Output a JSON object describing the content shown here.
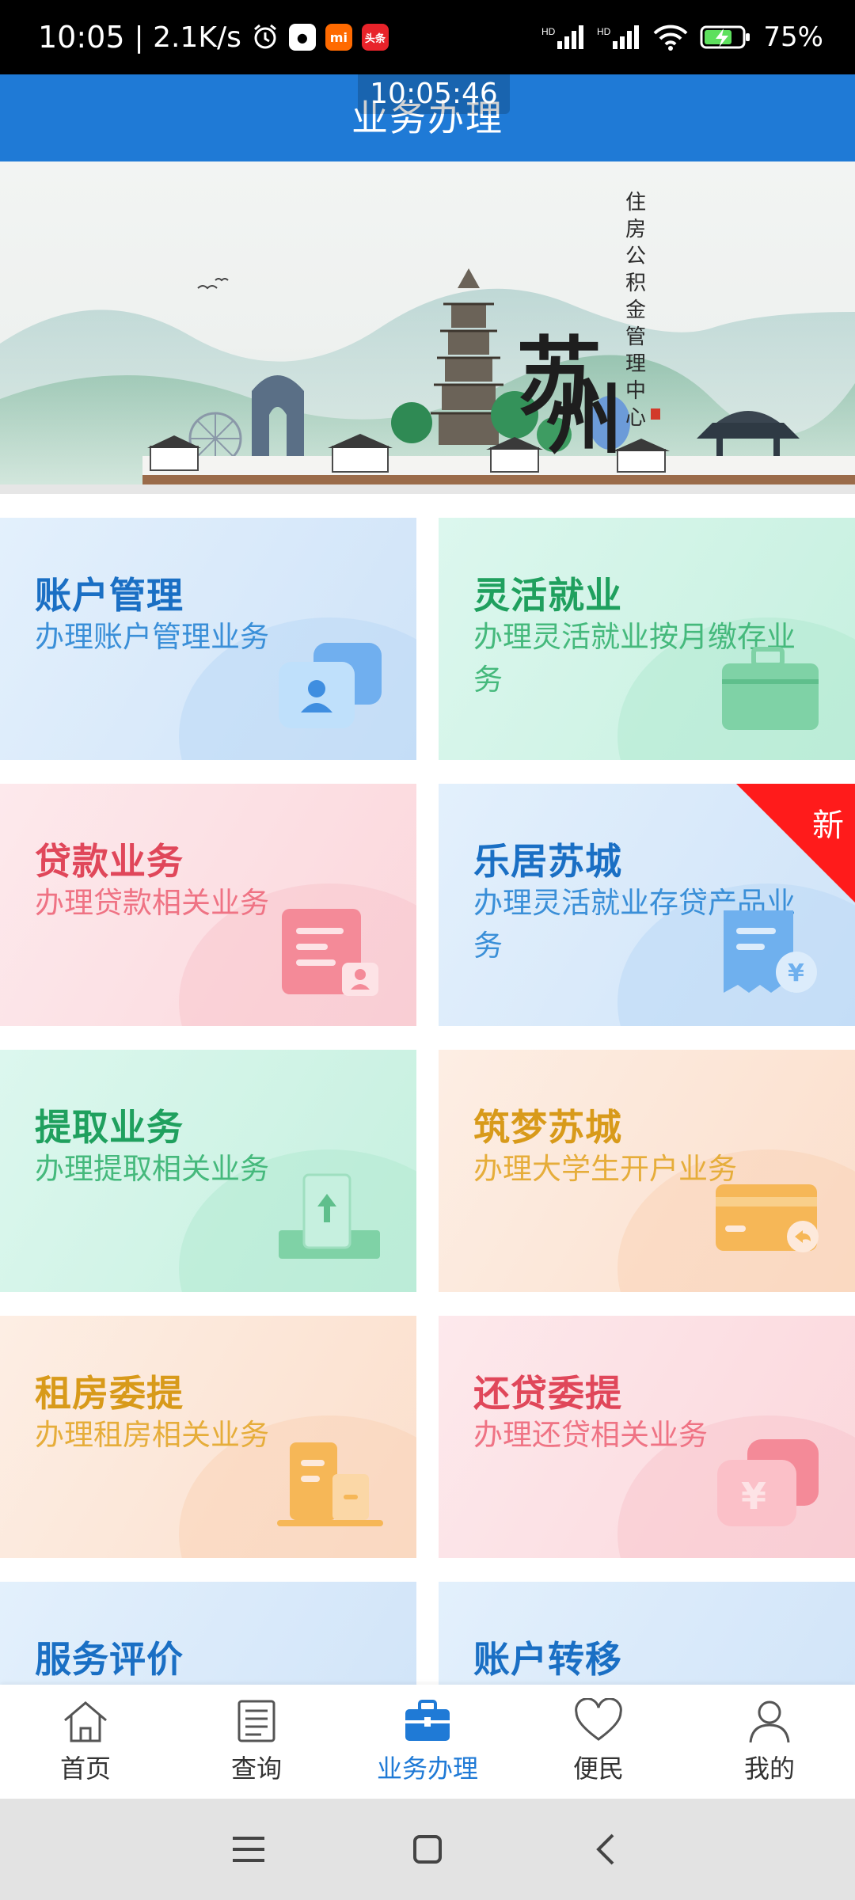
{
  "status_bar": {
    "time": "10:05",
    "speed": "| 2.1K/s",
    "battery": "75%",
    "overlay_clock": "10:05:46"
  },
  "header": {
    "title": "业务办理"
  },
  "banner": {
    "city": "苏州",
    "org": "住房公积金管理中心"
  },
  "cards": [
    {
      "title": "账户管理",
      "desc": "办理账户管理业务",
      "title_color": "#1a6fc4",
      "desc_color": "#3a8fd8",
      "bg": "#dcecfb",
      "icon": "account-card-icon"
    },
    {
      "title": "灵活就业",
      "desc": "办理灵活就业按月缴存业务",
      "title_color": "#1fa05e",
      "desc_color": "#45b97c",
      "bg": "#d8f5ea",
      "icon": "briefcase-icon"
    },
    {
      "title": "贷款业务",
      "desc": "办理贷款相关业务",
      "title_color": "#e0475a",
      "desc_color": "#ef7384",
      "bg": "#fde3e6",
      "icon": "loan-document-icon"
    },
    {
      "title": "乐居苏城",
      "desc": "办理灵活就业存贷产品业务",
      "title_color": "#1a6fc4",
      "desc_color": "#3a8fd8",
      "bg": "#dcecfb",
      "icon": "receipt-yuan-icon",
      "badge": "新"
    },
    {
      "title": "提取业务",
      "desc": "办理提取相关业务",
      "title_color": "#1fa05e",
      "desc_color": "#45b97c",
      "bg": "#d8f5ea",
      "icon": "withdraw-icon"
    },
    {
      "title": "筑梦苏城",
      "desc": "办理大学生开户业务",
      "title_color": "#d89a1a",
      "desc_color": "#e6ad3a",
      "bg": "#fde9db",
      "icon": "bank-card-icon"
    },
    {
      "title": "租房委提",
      "desc": "办理租房相关业务",
      "title_color": "#d89a1a",
      "desc_color": "#e6ad3a",
      "bg": "#fde9db",
      "icon": "building-icon"
    },
    {
      "title": "还贷委提",
      "desc": "办理还贷相关业务",
      "title_color": "#e0475a",
      "desc_color": "#ef7384",
      "bg": "#fde3e6",
      "icon": "repay-yuan-icon"
    },
    {
      "title": "服务评价",
      "desc": "",
      "title_color": "#1a6fc4",
      "desc_color": "#3a8fd8",
      "bg": "#dcecfb",
      "icon": ""
    },
    {
      "title": "账户转移",
      "desc": "",
      "title_color": "#1a6fc4",
      "desc_color": "#3a8fd8",
      "bg": "#dcecfb",
      "icon": ""
    }
  ],
  "bottom_nav": [
    {
      "label": "首页",
      "icon": "home-icon"
    },
    {
      "label": "查询",
      "icon": "document-icon"
    },
    {
      "label": "业务办理",
      "icon": "briefcase-icon",
      "active": true
    },
    {
      "label": "便民",
      "icon": "heart-icon"
    },
    {
      "label": "我的",
      "icon": "user-icon"
    }
  ],
  "colors": {
    "primary": "#1f7ad6",
    "badge_red": "#ff1b1b"
  }
}
